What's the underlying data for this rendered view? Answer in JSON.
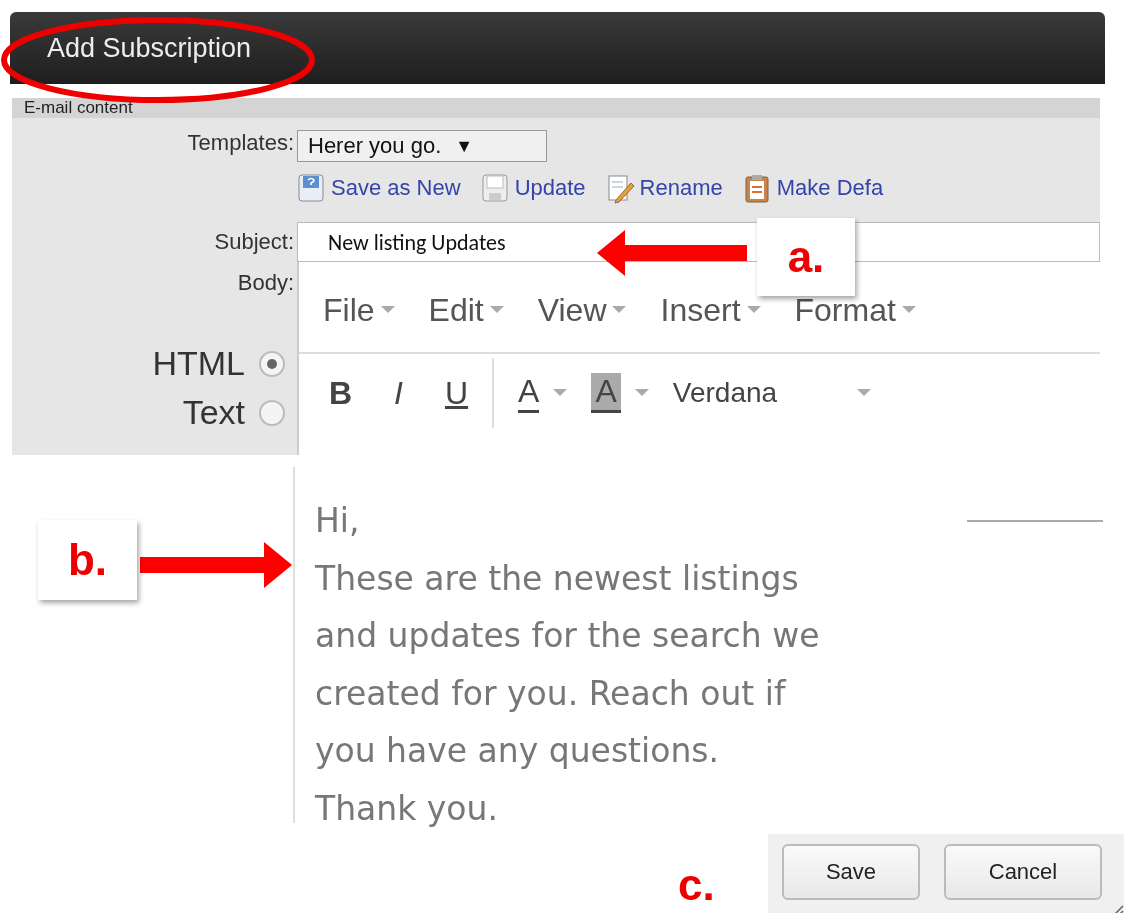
{
  "window": {
    "title": "Add Subscription"
  },
  "section": {
    "title": "E-mail content"
  },
  "templates": {
    "label": "Templates:",
    "value": "Herer you go.",
    "arrow": "▼"
  },
  "template_actions": [
    {
      "kind": "save-new",
      "label": "Save as New"
    },
    {
      "kind": "update",
      "label": "Update"
    },
    {
      "kind": "rename",
      "label": "Rename"
    },
    {
      "kind": "default",
      "label": "Make Defa"
    }
  ],
  "subject": {
    "label": "Subject:",
    "value": "New listing Updates"
  },
  "body": {
    "label": "Body:"
  },
  "formats": [
    {
      "label": "HTML",
      "selected": true
    },
    {
      "label": "Text",
      "selected": false
    }
  ],
  "editor": {
    "menus": [
      "File",
      "Edit",
      "View",
      "Insert",
      "Format"
    ],
    "tools": [
      {
        "kind": "bold",
        "label": "B"
      },
      {
        "kind": "italic",
        "label": "I"
      },
      {
        "kind": "underline",
        "label": "U"
      },
      {
        "kind": "sep"
      },
      {
        "kind": "text-color",
        "label": "A"
      },
      {
        "kind": "bg-color",
        "label": "A"
      },
      {
        "kind": "font",
        "label": "Verdana"
      }
    ],
    "lines": [
      "Hi,",
      "These are the newest listings",
      "and updates for the search we",
      "created for you. Reach out if",
      "you have any questions.",
      "Thank you."
    ]
  },
  "buttons": [
    "Save",
    "Cancel"
  ],
  "annotations": [
    {
      "kind": "box",
      "label": "a."
    },
    {
      "kind": "box",
      "label": "b."
    },
    {
      "kind": "plain",
      "label": "c."
    }
  ]
}
